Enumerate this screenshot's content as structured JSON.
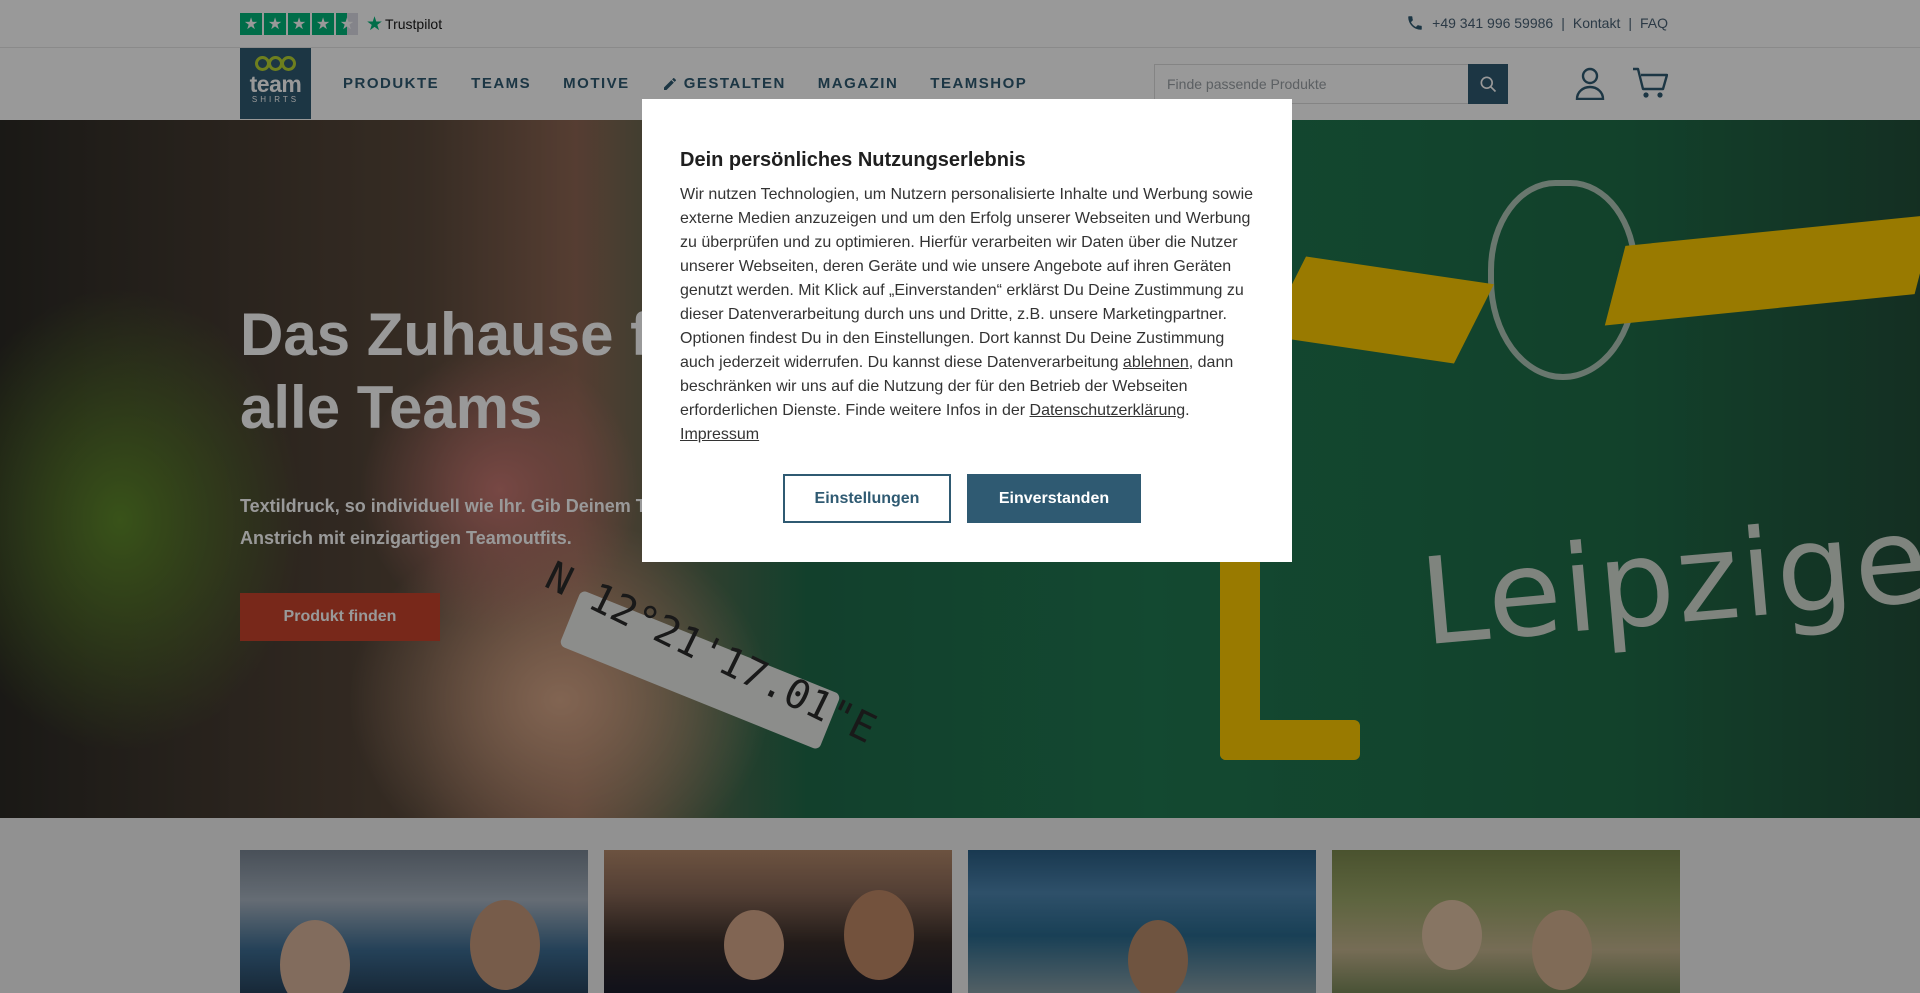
{
  "topbar": {
    "trustpilot_label": "Trustpilot",
    "rating_stars": 4.5,
    "phone": "+49 341 996 59986",
    "separator": "|",
    "contact": "Kontakt",
    "faq": "FAQ"
  },
  "header": {
    "logo_line1": "team",
    "logo_line2": "SHIRTS",
    "nav": [
      "PRODUKTE",
      "TEAMS",
      "MOTIVE",
      "GESTALTEN",
      "MAGAZIN",
      "TEAMSHOP"
    ],
    "search_placeholder": "Finde passende Produkte"
  },
  "hero": {
    "title_line1": "Das Zuhause für",
    "title_line2": "alle Teams",
    "text": "Textildruck, so individuell wie Ihr. Gib Deinem Team einen neuen Anstrich mit einzigartigen Teamoutfits.",
    "button": "Produkt finden",
    "image_text": "Leipziger",
    "image_coords": "N 12°21'17.01\"E"
  },
  "modal": {
    "title": "Dein persönliches Nutzungserlebnis",
    "text_part1": "Wir nutzen Technologien, um Nutzern personalisierte Inhalte und Werbung sowie externe Medien anzuzeigen und um den Erfolg unserer Webseiten und Werbung zu überprüfen und zu optimieren. Hierfür verarbeiten wir Daten über die Nutzer unserer Webseiten, deren Geräte und wie unsere Angebote auf ihren Geräten genutzt werden. Mit Klick auf „Einverstanden“ erklärst Du Deine Zustimmung zu dieser Datenverarbeitung durch uns und Dritte, z.B. unsere Marketingpartner. Optionen findest Du in den Einstellungen. Dort kannst Du Deine Zustimmung auch jederzeit widerrufen. Du kannst diese Datenverarbeitung ",
    "link_reject": "ablehnen",
    "text_part2": ", dann beschränken wir uns auf die Nutzung der für den Betrieb der Webseiten erforderlichen Dienste. Finde weitere Infos in der ",
    "link_privacy": "Datenschutzerklärung",
    "text_part3": ".",
    "link_imprint": "Impressum",
    "btn_settings": "Einstellungen",
    "btn_accept": "Einverstanden"
  },
  "colors": {
    "brand": "#2f5a72",
    "accent": "#c8442c",
    "logo_green": "#b8d433",
    "trustpilot_green": "#00b67a"
  }
}
